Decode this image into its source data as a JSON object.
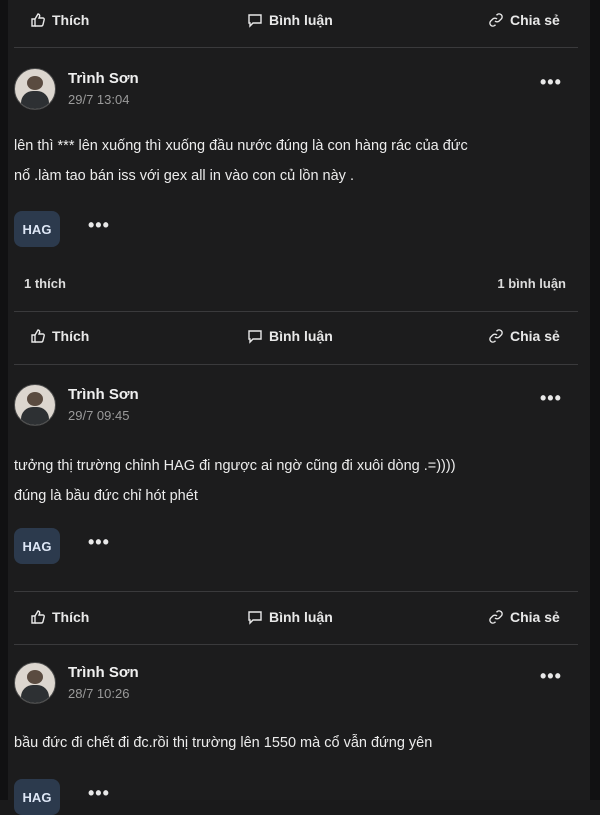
{
  "actions": {
    "like_label": "Thích",
    "comment_label": "Bình luận",
    "share_label": "Chia sẻ"
  },
  "posts": [
    {
      "author": "Trình Sơn",
      "time": "29/7 13:04",
      "text_lines": [
        "lên thì *** lên xuống thì xuống đầu nước đúng là con hàng rác của đức",
        "nổ .làm tao bán iss với gex all in vào con củ lồn này ."
      ],
      "tag": "HAG",
      "more": "•••",
      "likes": "1 thích",
      "comments": "1 bình luận"
    },
    {
      "author": "Trình Sơn",
      "time": "29/7 09:45",
      "text_lines": [
        "tưởng thị trường chỉnh HAG đi ngược ai ngờ cũng đi xuôi dòng .=))))",
        "đúng là bầu đức chỉ hót phét"
      ],
      "tag": "HAG",
      "more": "•••"
    },
    {
      "author": "Trình Sơn",
      "time": "28/7 10:26",
      "text_lines": [
        "bầu đức đi chết đi đc.rồi thị trường lên 1550 mà cổ vẫn đứng yên"
      ],
      "tag": "HAG",
      "more": "•••"
    }
  ],
  "icons": {
    "like": "thumbs-up-icon",
    "comment": "comment-icon",
    "share": "link-icon",
    "more": "more-icon"
  }
}
